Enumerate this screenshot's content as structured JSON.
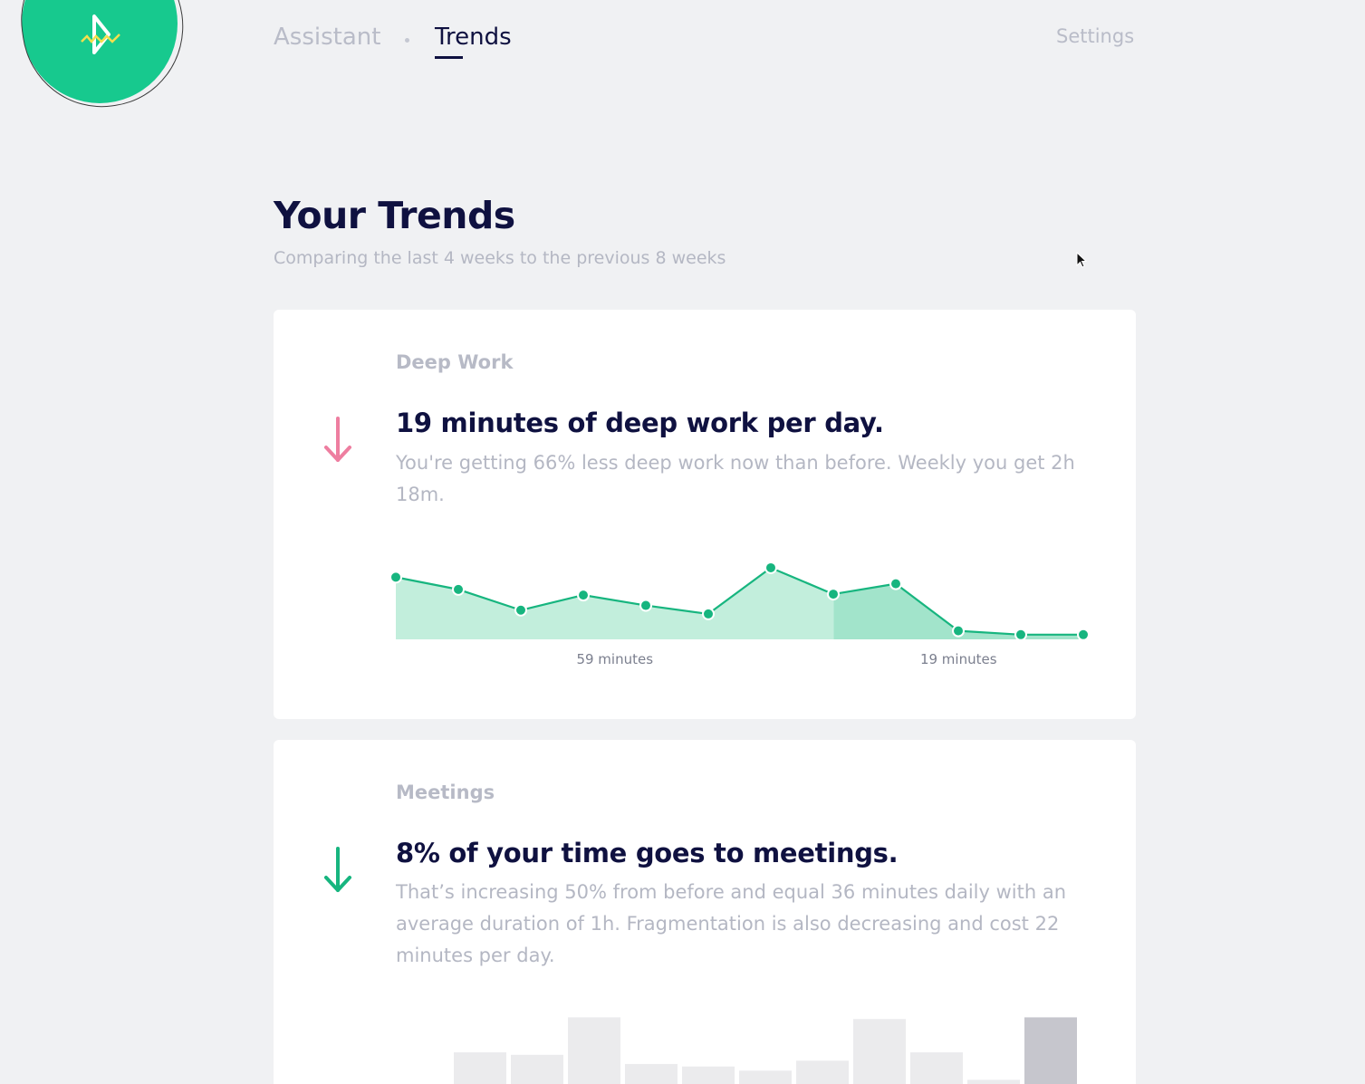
{
  "nav": {
    "items": [
      {
        "label": "Assistant",
        "active": false
      },
      {
        "label": "Trends",
        "active": true
      }
    ],
    "settings_label": "Settings"
  },
  "colors": {
    "brand_green": "#17c98e",
    "navy": "#0f1140",
    "muted": "#b4b7c3",
    "arrow_down_bad": "#ee7ea0",
    "arrow_down_good": "#17b57f"
  },
  "header": {
    "title": "Your Trends",
    "subtitle": "Comparing the last 4 weeks to the previous 8 weeks"
  },
  "cards": [
    {
      "label": "Deep Work",
      "heading": "19 minutes of deep work per day.",
      "description": "You're getting 66% less deep work now than before. Weekly you get 2h 18m.",
      "trend_icon": "arrow-down-icon",
      "trend_color": "#ee7ea0"
    },
    {
      "label": "Meetings",
      "heading": "8% of your time goes to meetings.",
      "description": "That’s increasing 50% from before and equal 36 minutes daily with an average duration of 1h. Fragmentation is also decreasing and cost 22 minutes per day.",
      "trend_icon": "arrow-down-icon",
      "trend_color": "#17b57f"
    }
  ],
  "chart_data": [
    {
      "type": "area",
      "series": [
        {
          "values": [
            66,
            53,
            31,
            47,
            36,
            27,
            76,
            48,
            59,
            9,
            5,
            5
          ]
        }
      ],
      "ylim": [
        0,
        100
      ],
      "previous_period_count": 8,
      "recent_period_count": 4,
      "tick_labels": [
        "59 minutes",
        "19 minutes"
      ],
      "grid": false
    },
    {
      "type": "bar",
      "values": [
        38,
        35,
        80,
        24,
        21,
        16,
        28,
        78,
        38,
        5,
        80
      ],
      "ylim": [
        0,
        100
      ],
      "highlighted_index": 10,
      "grid": false
    }
  ]
}
